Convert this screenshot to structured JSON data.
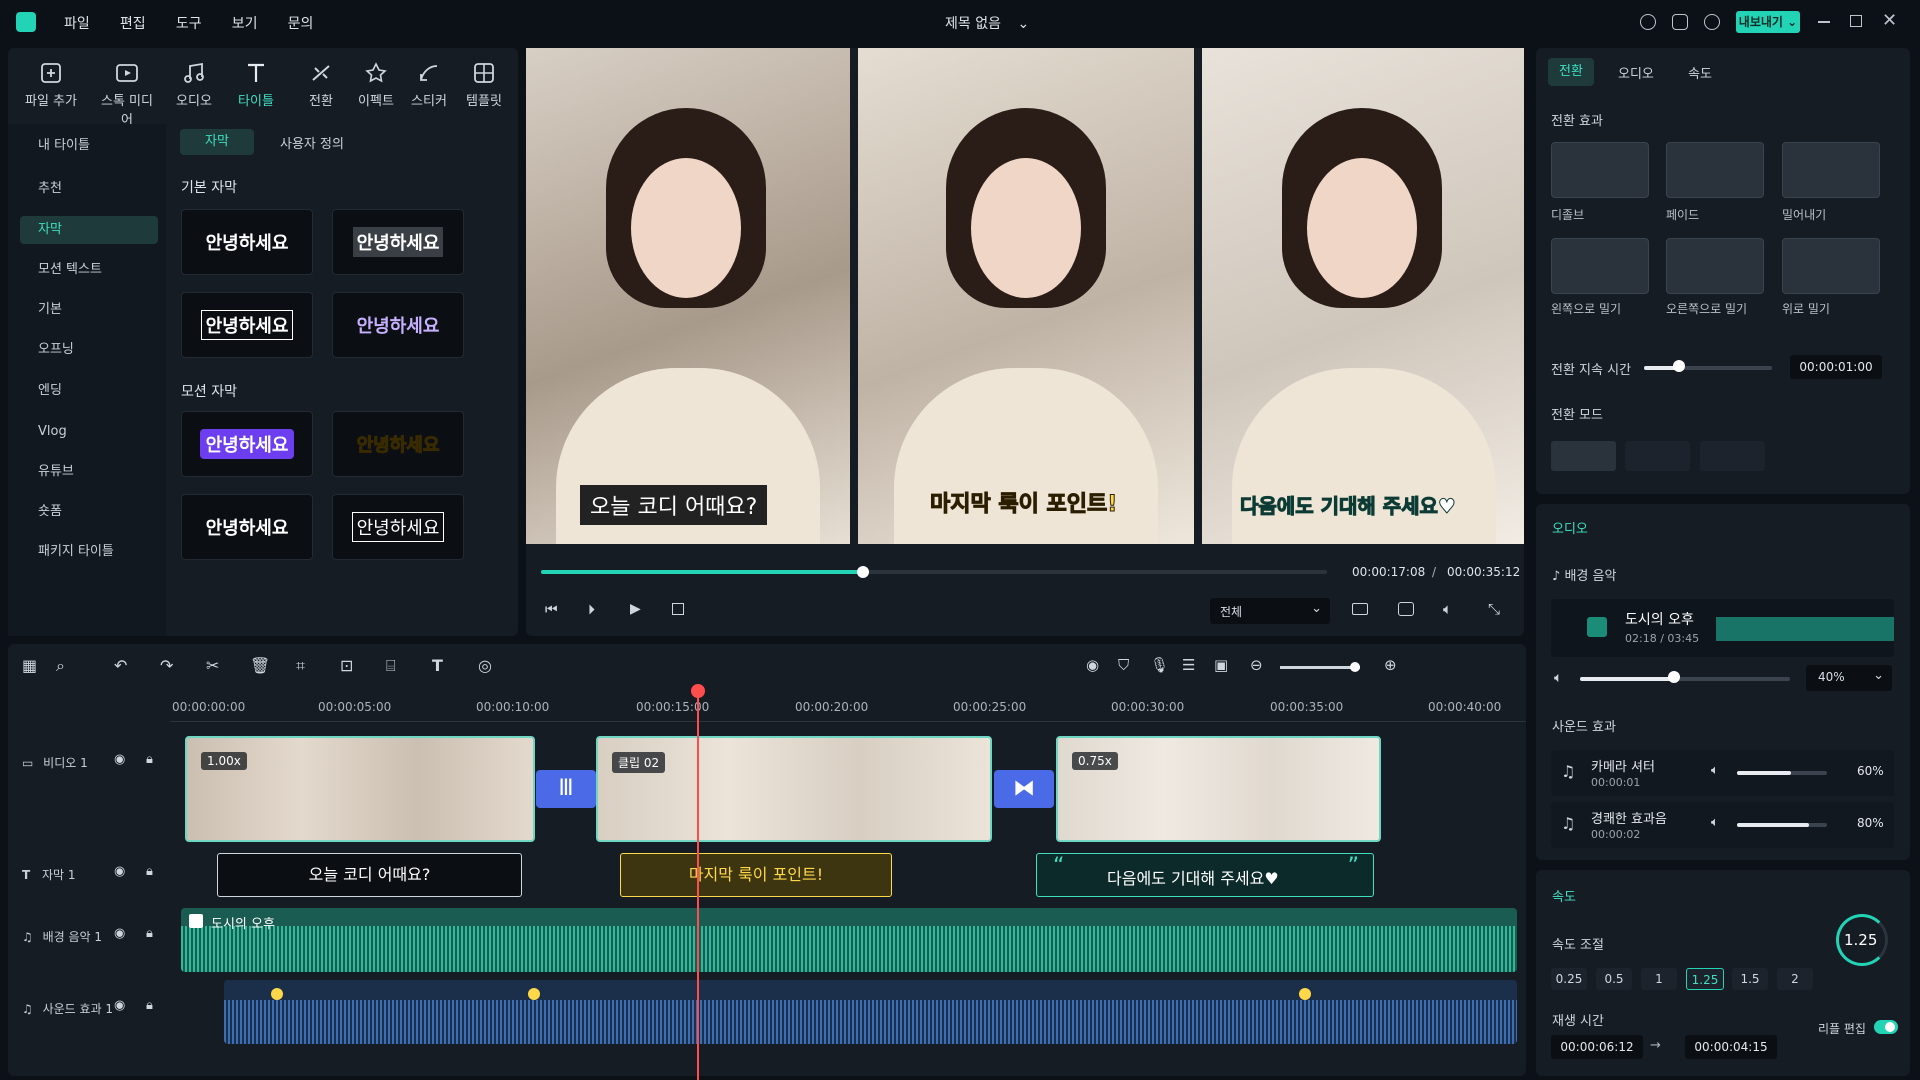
{
  "menu": {
    "items": [
      "파일",
      "편집",
      "도구",
      "보기",
      "문의"
    ]
  },
  "title": "제목 없음",
  "export_label": "내보내기",
  "toolbar": [
    {
      "label": "파일 추가",
      "icon": "file-add-icon"
    },
    {
      "label": "스톡 미디어",
      "icon": "stock-media-icon"
    },
    {
      "label": "오디오",
      "icon": "music-icon"
    },
    {
      "label": "타이틀",
      "icon": "title-icon"
    },
    {
      "label": "전환",
      "icon": "transition-icon"
    },
    {
      "label": "이펙트",
      "icon": "effect-icon"
    },
    {
      "label": "스티커",
      "icon": "sticker-icon"
    },
    {
      "label": "템플릿",
      "icon": "template-icon"
    }
  ],
  "sidebar": {
    "items": [
      "내 타이틀",
      "추천",
      "자막",
      "모션 텍스트",
      "기본",
      "오프닝",
      "엔딩",
      "Vlog",
      "유튜브",
      "숏폼",
      "패키지 타이틀"
    ]
  },
  "title_panel": {
    "tabs": [
      "자막",
      "사용자 정의"
    ],
    "basic_section": "기본 자막",
    "motion_section": "모션 자막",
    "sample": "안녕하세요"
  },
  "preview": {
    "subtitles": [
      "오늘 코디 어때요?",
      "마지막 룩이 포인트!",
      "다음에도 기대해 주세요♥"
    ],
    "current_time": "00:00:17:08",
    "separator": "/",
    "total_time": "00:00:35:12",
    "progress": 0.41,
    "quality": "전체"
  },
  "right_tabs": [
    "전환",
    "오디오",
    "속도"
  ],
  "transition": {
    "section": "전환 효과",
    "effects": [
      "디졸브",
      "페이드",
      "밀어내기",
      "왼쪽으로 밀기",
      "오른쪽으로 밀기",
      "위로 밀기"
    ],
    "duration_label": "전환 지속 시간",
    "duration_value": "00:00:01:00",
    "mode_label": "전환 모드"
  },
  "audio": {
    "section": "오디오",
    "bgm_label": "배경 음악",
    "track_name": "도시의 오후",
    "track_time": "02:18 / 03:45",
    "volume": "40%",
    "sfx_label": "사운드 효과",
    "sfx": [
      {
        "name": "카메라 셔터",
        "time": "00:00:01",
        "volume": "60%",
        "level": 0.6
      },
      {
        "name": "경쾌한 효과음",
        "time": "00:00:02",
        "volume": "80%",
        "level": 0.8
      }
    ]
  },
  "speed": {
    "section": "속도",
    "adjust_label": "속도 조절",
    "value": "1.25",
    "options": [
      "0.25",
      "0.5",
      "1",
      "1.25",
      "1.5",
      "2"
    ],
    "play_time_label": "재생 시간",
    "ripple_label": "리플 편집",
    "time_from": "00:00:06:12",
    "arrow": "→",
    "time_to": "00:00:04:15"
  },
  "timeline": {
    "ticks": [
      "00:00:00:00",
      "00:00:05:00",
      "00:00:10:00",
      "00:00:15:00",
      "00:00:20:00",
      "00:00:25:00",
      "00:00:30:00",
      "00:00:35:00",
      "00:00:40:00"
    ],
    "tracks": [
      "비디오 1",
      "자막 1",
      "배경 음악 1",
      "사운드 효과 1"
    ],
    "clip_speeds": [
      "1.00x",
      "클립 02",
      "0.75x"
    ],
    "subtitle_clips": [
      "오늘 코디 어때요?",
      "마지막 룩이 포인트!",
      "다음에도 기대해 주세요♥"
    ],
    "music_clip": "도시의 오후",
    "quote_open": "“",
    "quote_close": "”"
  }
}
